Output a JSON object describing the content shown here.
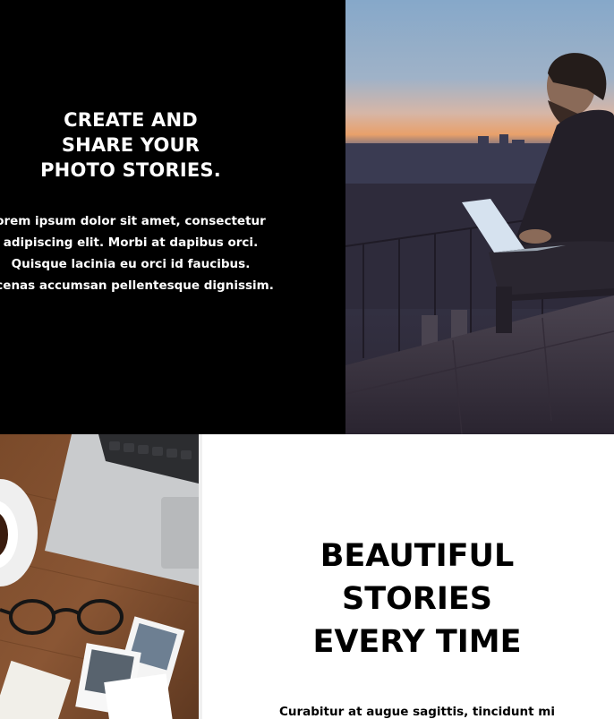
{
  "hero": {
    "title": "CREATE AND\nSHARE YOUR\nPHOTO STORIES.",
    "body": "orem ipsum dolor sit amet, consectetur\nadipiscing elit. Morbi at dapibus orci.\nQuisque lacinia eu orci id faucibus.\necenas accumsan pellentesque dignissim."
  },
  "feature": {
    "title": "BEAUTIFUL\nSTORIES\nEVERY TIME",
    "body": "Curabitur at augue sagittis, tincidunt mi"
  },
  "images": {
    "top_right": "photo-man-laptop-city-sunset",
    "bottom_left": "photo-desk-laptop-coffee-glasses-polaroids"
  },
  "colors": {
    "hero_background": "#000000",
    "hero_text": "#ffffff",
    "feature_background": "#ffffff",
    "feature_text": "#000000"
  }
}
